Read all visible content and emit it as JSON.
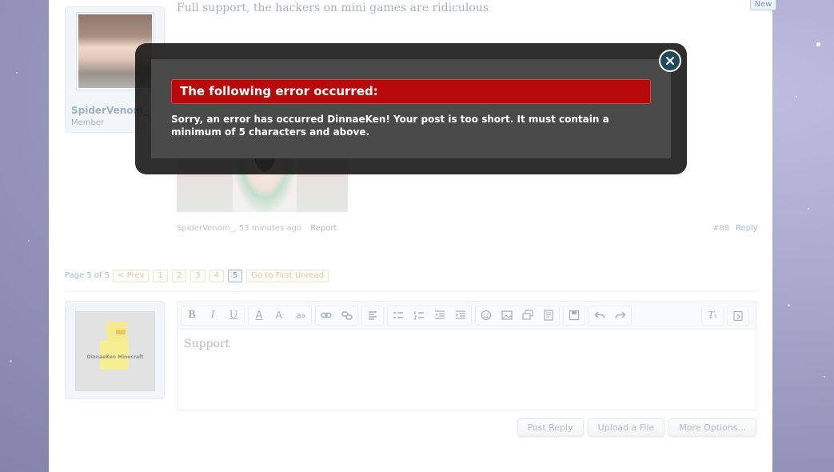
{
  "post": {
    "text": "Full support, the hackers on mini games are ridiculous",
    "new_badge": "New",
    "author_name": "SpiderVenom_",
    "author_title": "Member",
    "meta_author": "SpiderVenom_",
    "meta_time": ", 53 minutes ago",
    "report_label": "Report",
    "post_number": "#88",
    "reply_label": "Reply"
  },
  "pagination": {
    "label": "Page 5 of 5",
    "prev_label": "< Prev",
    "pages": [
      "1",
      "2",
      "3",
      "4",
      "5"
    ],
    "current_page": "5",
    "first_unread_label": "Go to First Unread"
  },
  "reply_box": {
    "avatar_caption": "DinnaeKen Minecraft",
    "editor_text": "Support",
    "toolbar_icons": [
      "bold-icon",
      "italic-icon",
      "underline-icon",
      "font-color-icon",
      "font-size-icon",
      "font-family-icon",
      "link-icon",
      "unlink-icon",
      "align-icon",
      "bullet-list-icon",
      "numbered-list-icon",
      "outdent-icon",
      "indent-icon",
      "smilies-icon",
      "image-icon",
      "media-icon",
      "code-icon",
      "save-draft-icon",
      "undo-icon",
      "redo-icon",
      "remove-format-icon",
      "toggle-bbcode-icon"
    ]
  },
  "actions": {
    "post_reply": "Post Reply",
    "upload_file": "Upload a File",
    "more_options": "More Options..."
  },
  "error_modal": {
    "title": "The following error occurred:",
    "message": "Sorry, an error has occurred DinnaeKen! Your post is too short. It must contain a minimum of 5 characters and above.",
    "close_icon": "close-icon",
    "header_color": "#b80a0a"
  }
}
